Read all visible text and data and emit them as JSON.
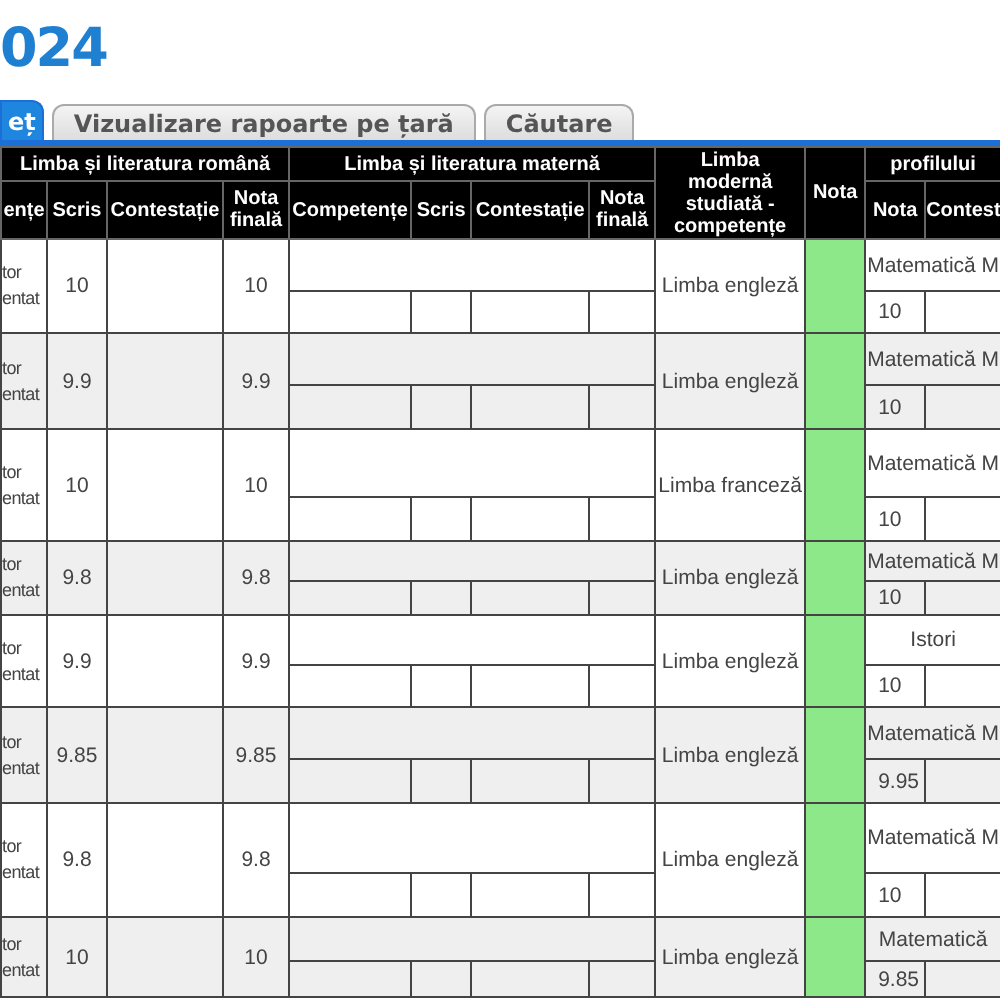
{
  "title": "024",
  "tabs": [
    {
      "label": "eț",
      "selected": true
    },
    {
      "label": "Vizualizare rapoarte pe țară",
      "selected": false
    },
    {
      "label": "Căutare",
      "selected": false
    }
  ],
  "table": {
    "group_headers": [
      "Limba și literatura română",
      "Limba și literatura maternă",
      "Limba modernă studiată - competențe",
      "Nota",
      "profilului"
    ],
    "columns": [
      "ențe",
      "Scris",
      "Contestație",
      "Nota finală",
      "Competențe",
      "Scris",
      "Contestație",
      "Nota finală",
      "Nota",
      "Contest"
    ],
    "rows": [
      {
        "column_1": "tor entat",
        "scris": "10",
        "nota_finala": "10",
        "limba_moderna": "Limba engleză",
        "disciplina": "Matematică M",
        "disciplina_nota": "10"
      },
      {
        "column_1": "tor entat",
        "scris": "9.9",
        "nota_finala": "9.9",
        "limba_moderna": "Limba engleză",
        "disciplina": "Matematică M",
        "disciplina_nota": "10"
      },
      {
        "column_1": "tor entat",
        "scris": "10",
        "nota_finala": "10",
        "limba_moderna": "Limba franceză",
        "disciplina": "Matematică M",
        "disciplina_nota": "10"
      },
      {
        "column_1": "tor entat",
        "scris": "9.8",
        "nota_finala": "9.8",
        "limba_moderna": "Limba engleză",
        "disciplina": "Matematică M",
        "disciplina_nota": "10"
      },
      {
        "column_1": "tor entat",
        "scris": "9.9",
        "nota_finala": "9.9",
        "limba_moderna": "Limba engleză",
        "disciplina": "Istori",
        "disciplina_nota": "10"
      },
      {
        "column_1": "tor entat",
        "scris": "9.85",
        "nota_finala": "9.85",
        "limba_moderna": "Limba engleză",
        "disciplina": "Matematică M",
        "disciplina_nota": "9.95"
      },
      {
        "column_1": "tor entat",
        "scris": "9.8",
        "nota_finala": "9.8",
        "limba_moderna": "Limba engleză",
        "disciplina": "Matematică M",
        "disciplina_nota": "10"
      },
      {
        "column_1": "tor entat",
        "scris": "10",
        "nota_finala": "10",
        "limba_moderna": "Limba engleză",
        "disciplina": "Matematică",
        "disciplina_nota": "9.85"
      }
    ]
  }
}
